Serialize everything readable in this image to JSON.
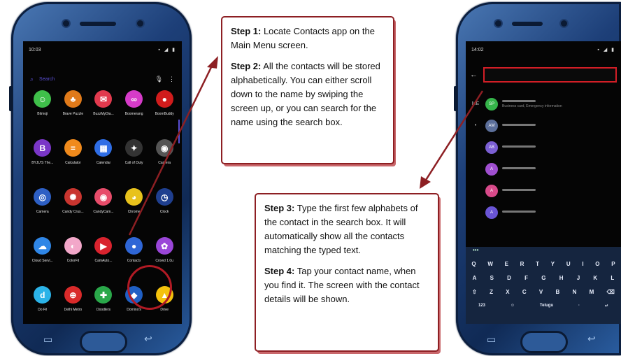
{
  "left_phone": {
    "status_time": "10:03",
    "status_icons": "▪ ◢ ▮",
    "search_placeholder": "Search",
    "apps": [
      {
        "name": "Bitmoji",
        "color": "#3fbf4a",
        "glyph": "☺"
      },
      {
        "name": "Brave Puzzle",
        "color": "#e07a1a",
        "glyph": "♣"
      },
      {
        "name": "BuzzMyDia...",
        "color": "#e23a4e",
        "glyph": "✉"
      },
      {
        "name": "Boomerang",
        "color": "#d63bc9",
        "glyph": "∞"
      },
      {
        "name": "BoomBuddy",
        "color": "#d11c1c",
        "glyph": "●"
      },
      {
        "name": "BYJU'S The...",
        "color": "#7a36c7",
        "glyph": "B"
      },
      {
        "name": "Calculator",
        "color": "#f08a1c",
        "glyph": "="
      },
      {
        "name": "Calendar",
        "color": "#2f6ee6",
        "glyph": "▦"
      },
      {
        "name": "Call of Duty",
        "color": "#333333",
        "glyph": "✦"
      },
      {
        "name": "Camera",
        "color": "#555555",
        "glyph": "◉"
      },
      {
        "name": "Camera",
        "color": "#2d5fc4",
        "glyph": "◎"
      },
      {
        "name": "Candy Crus...",
        "color": "#c9352f",
        "glyph": "✺"
      },
      {
        "name": "CandyCam...",
        "color": "#e74c6a",
        "glyph": "◉"
      },
      {
        "name": "Chrome",
        "color": "#e8c21c",
        "glyph": "◕"
      },
      {
        "name": "Clock",
        "color": "#1f3f8f",
        "glyph": "◷"
      },
      {
        "name": "Cloud Servi...",
        "color": "#2f86e6",
        "glyph": "☁"
      },
      {
        "name": "ColorFit",
        "color": "#f2a7c9",
        "glyph": "◐"
      },
      {
        "name": "CamAuto...",
        "color": "#d9232e",
        "glyph": "▶"
      },
      {
        "name": "Contacts",
        "color": "#2f66d6",
        "glyph": "●"
      },
      {
        "name": "Crowd 1.0u",
        "color": "#9a46d8",
        "glyph": "✿"
      },
      {
        "name": "Do Fit",
        "color": "#2bb3e8",
        "glyph": "d"
      },
      {
        "name": "Delhi Metro",
        "color": "#d92a2a",
        "glyph": "⊕"
      },
      {
        "name": "Doodlers",
        "color": "#2aa84a",
        "glyph": "✚"
      },
      {
        "name": "Domino's",
        "color": "#1f5fc4",
        "glyph": "◆"
      },
      {
        "name": "Drive",
        "color": "#f4c20d",
        "glyph": "▲"
      }
    ]
  },
  "right_phone": {
    "status_time": "14:02",
    "status_icons": "▪ ◢ ▮",
    "contacts": [
      {
        "letter": "ME",
        "initials": "SP",
        "color": "#35b44a",
        "sub": "Business card, Emergency information"
      },
      {
        "letter": "•",
        "initials": "AM",
        "color": "#5c6f9a",
        "sub": ""
      },
      {
        "letter": "",
        "initials": "AB",
        "color": "#7b5fd3",
        "sub": ""
      },
      {
        "letter": "",
        "initials": "A",
        "color": "#a04fd0",
        "sub": ""
      },
      {
        "letter": "",
        "initials": "A",
        "color": "#d84a8a",
        "sub": ""
      },
      {
        "letter": "",
        "initials": "A",
        "color": "#6a55d6",
        "sub": ""
      }
    ],
    "keyboard": {
      "toolbar": "•••",
      "row1": [
        "Q",
        "W",
        "E",
        "R",
        "T",
        "Y",
        "U",
        "I",
        "O",
        "P"
      ],
      "row2": [
        "A",
        "S",
        "D",
        "F",
        "G",
        "H",
        "J",
        "K",
        "L"
      ],
      "row3": [
        "⇧",
        "Z",
        "X",
        "C",
        "V",
        "B",
        "N",
        "M",
        "⌫"
      ],
      "row4": [
        "123",
        "☺",
        "Telugu",
        "·",
        "↵"
      ]
    }
  },
  "callout1": {
    "step1_title": "Step 1:",
    "step1_text": " Locate Contacts app on the Main Menu screen.",
    "step2_title": "Step 2:",
    "step2_text": " All the contacts will be stored alphabetically. You can either scroll down to the name by swiping the screen up, or you can search for the name using the search box."
  },
  "callout2": {
    "step3_title": "Step 3:",
    "step3_text": " Type the first few alphabets of the contact in the search box. It will automatically show all the contacts matching the typed text.",
    "step4_title": "Step 4:",
    "step4_text": " Tap your contact name, when you find it. The screen with the contact details will be shown."
  },
  "colors": {
    "accent_red": "#8d1f23",
    "highlight_red": "#d21e26",
    "phone_blue": "#1d3f78"
  }
}
